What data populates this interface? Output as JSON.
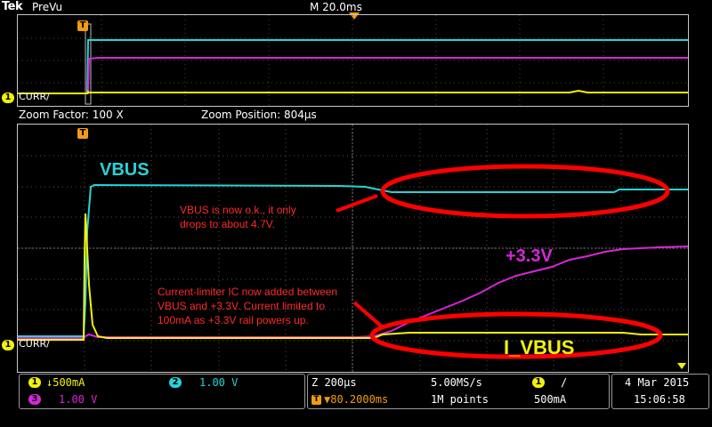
{
  "header": {
    "brand": "Tek",
    "mode": "PreVu",
    "timebase": "M 20.0ms"
  },
  "overview": {
    "ch1_label": "CURR/",
    "trigger_label": "T"
  },
  "zoom": {
    "factor": "Zoom Factor: 100 X",
    "position": "Zoom Position: 804µs"
  },
  "main": {
    "trigger_label": "T",
    "ch1_label": "CURR/",
    "vbus_title": "VBUS",
    "vbus_note_line1": "VBUS is now o.k., it only",
    "vbus_note_line2": "drops to about 4.7V.",
    "rail_title": "+3.3V",
    "limiter_note_line1": "Current-limiter IC now added between",
    "limiter_note_line2": "VBUS and +3.3V. Current limited to",
    "limiter_note_line3": "100mA as +3.3V rail powers up.",
    "ivbus_title": "I_VBUS"
  },
  "status": {
    "ch1_num": "1",
    "ch1_scale": "↓500mA",
    "ch2_num": "2",
    "ch2_scale": "1.00 V",
    "ch3_num": "3",
    "ch3_scale": "1.00 V",
    "zoom_time": "Z 200µs",
    "sample_rate": "5.00MS/s",
    "trig_pos": "▼80.2000ms",
    "record_len": "1M points",
    "trig_ch": "1",
    "trig_slope": "/",
    "trig_level": "500mA",
    "date": "4 Mar  2015",
    "time": "15:06:58"
  },
  "colors": {
    "ch1": "#f2f20a",
    "ch2": "#27d3d8",
    "ch3": "#d726d7",
    "annotation": "#ff2a2a",
    "trigger": "#f39c12"
  }
}
